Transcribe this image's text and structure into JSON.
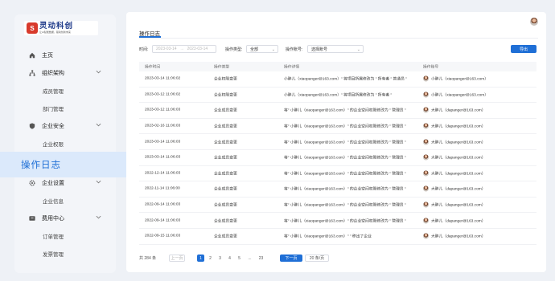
{
  "brand": {
    "mark": "S",
    "name": "灵动科创",
    "slogan": "让AI赋能数据，驱动创新未来"
  },
  "sidebar": {
    "items": [
      {
        "type": "group",
        "label": "主页",
        "icon": "home-icon",
        "chevron": false
      },
      {
        "type": "group",
        "label": "组织架构",
        "icon": "org-icon",
        "chevron": true
      },
      {
        "type": "sub",
        "label": "成员管理"
      },
      {
        "type": "sub",
        "label": "部门管理"
      },
      {
        "type": "group",
        "label": "企业安全",
        "icon": "shield-icon",
        "chevron": true
      },
      {
        "type": "sub",
        "label": "企业权限"
      },
      {
        "type": "active",
        "label": "操作日志"
      },
      {
        "type": "group",
        "label": "企业设置",
        "icon": "gear-icon",
        "chevron": true
      },
      {
        "type": "sub",
        "label": "企业信息"
      },
      {
        "type": "group",
        "label": "费用中心",
        "icon": "wallet-icon",
        "chevron": true
      },
      {
        "type": "sub",
        "label": "订单管理"
      },
      {
        "type": "sub",
        "label": "发票管理"
      }
    ]
  },
  "main": {
    "tab": "操作日志",
    "filters": {
      "time_label": "时间:",
      "date_start": "2023-03-14",
      "date_sep": "→",
      "date_end": "2023-03-14",
      "type_label": "操作类型:",
      "type_value": "全部",
      "account_label": "操作账号:",
      "account_value": "选择账号",
      "export_label": "导出"
    },
    "table": {
      "headers": [
        "操作时间",
        "操作类型",
        "操作详情",
        "操作账号"
      ],
      "rows": [
        {
          "time": "2023-03-14 11:06:02",
          "type": "企业权限变更",
          "detail": "小胖儿（xiaopanger@163.com）\" 将项目所属修改为 \" 所有者 \" 普通员 \"",
          "account": "小胖儿（xiaopanger@163.com）"
        },
        {
          "time": "2023-03-12 11:06:02",
          "type": "企业权限变更",
          "detail": "小胖儿（xiaopanger@163.com）\" 将项目所属修改为 \" 所有者 \"",
          "account": "小胖儿（xiaopanger@163.com）"
        },
        {
          "time": "2023-03-12 11:06:03",
          "type": "企业成员变更",
          "detail": "将\" 小胖儿（xiaopanger@163.com）\" 的企业空间权限修改为 \" 管理员 \"",
          "account": "大胖儿（dapanger@163.com）"
        },
        {
          "time": "2023-02-16 11:06:03",
          "type": "企业成员变更",
          "detail": "将\" 小胖儿（xiaopanger@163.com）\" 的企业空间权限修改为 \" 管理员 \"",
          "account": "大胖儿（dapanger@163.com）"
        },
        {
          "time": "2023-03-14 11:06:03",
          "type": "企业成员变更",
          "detail": "将\" 小胖儿（xiaopanger@163.com）\" 的企业空间权限修改为 \" 管理员 \"",
          "account": "大胖儿（dapanger@163.com）"
        },
        {
          "time": "2023-03-14 11:06:03",
          "type": "企业成员变更",
          "detail": "将\" 小胖儿（xiaopanger@163.com）\" 的企业空间权限修改为 \" 管理员 \"",
          "account": "大胖儿（dapanger@163.com）"
        },
        {
          "time": "2022-12-14 11:06:03",
          "type": "企业成员变更",
          "detail": "将\" 小胖儿（xiaopanger@163.com）\" 的企业空间权限修改为 \" 管理员 \"",
          "account": "大胖儿（dapanger@163.com）"
        },
        {
          "time": "2022-11-14 11:06:00",
          "type": "企业成员变更",
          "detail": "将\" 小胖儿（xiaopanger@163.com）\" 的企业空间权限修改为 \" 管理员 \"",
          "account": "大胖儿（dapanger@163.com）"
        },
        {
          "time": "2022-09-14 11:06:03",
          "type": "企业成员变更",
          "detail": "将\" 小胖儿（xiaopanger@163.com）\" 的企业空间权限修改为 \" 管理员 \"",
          "account": "大胖儿（dapanger@163.com）"
        },
        {
          "time": "2022-09-14 11:06:03",
          "type": "企业成员变更",
          "detail": "将\" 小胖儿（xiaopanger@163.com）\" 的企业空间权限修改为 \" 管理员 \"",
          "account": "大胖儿（dapanger@163.com）"
        },
        {
          "time": "2022-09-15 11:06:03",
          "type": "企业成员变更",
          "detail": "将\" 小胖儿（xiaopanger@163.com）\" \" 移出了企业",
          "account": "大胖儿（dapanger@163.com）"
        }
      ]
    },
    "pager": {
      "total": "共 284 条",
      "prev": "上一页",
      "pages": [
        "1",
        "2",
        "3",
        "4",
        "5",
        "...",
        "23"
      ],
      "current": "1",
      "next": "下一页",
      "page_size": "20 条/页"
    }
  }
}
